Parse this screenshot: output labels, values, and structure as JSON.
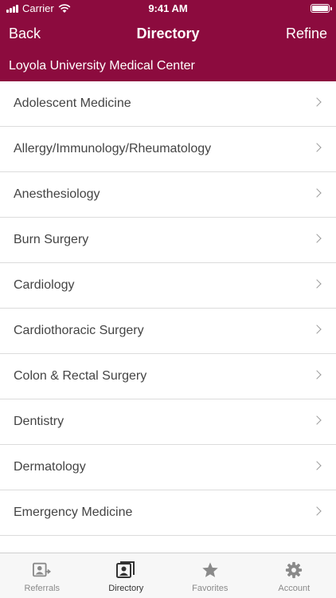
{
  "status_bar": {
    "carrier": "Carrier",
    "time": "9:41 AM"
  },
  "nav": {
    "back_label": "Back",
    "title": "Directory",
    "refine_label": "Refine"
  },
  "subtitle": "Loyola University Medical Center",
  "list": {
    "items": [
      {
        "label": "Adolescent Medicine"
      },
      {
        "label": "Allergy/Immunology/Rheumatology"
      },
      {
        "label": "Anesthesiology"
      },
      {
        "label": "Burn Surgery"
      },
      {
        "label": "Cardiology"
      },
      {
        "label": "Cardiothoracic Surgery"
      },
      {
        "label": "Colon & Rectal Surgery"
      },
      {
        "label": "Dentistry"
      },
      {
        "label": "Dermatology"
      },
      {
        "label": "Emergency Medicine"
      }
    ]
  },
  "tabbar": {
    "tabs": [
      {
        "label": "Referrals",
        "icon": "referrals-icon"
      },
      {
        "label": "Directory",
        "icon": "directory-icon"
      },
      {
        "label": "Favorites",
        "icon": "star-icon"
      },
      {
        "label": "Account",
        "icon": "gear-icon"
      }
    ],
    "active": "Directory"
  },
  "colors": {
    "brand": "#8c0b3e",
    "tab_inactive": "#8a8a8a",
    "tab_active": "#333333"
  }
}
